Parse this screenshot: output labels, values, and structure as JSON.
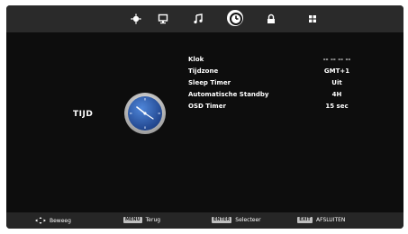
{
  "tabs": [
    {
      "icon": "picture-icon"
    },
    {
      "icon": "monitor-icon"
    },
    {
      "icon": "music-note-icon"
    },
    {
      "icon": "clock-tab-icon",
      "active": true
    },
    {
      "icon": "lock-icon"
    },
    {
      "icon": "grid-icon"
    }
  ],
  "section": {
    "label": "TIJD",
    "icon": "clock-icon",
    "accent": "#2d5fb0"
  },
  "settings": [
    {
      "label": "Klok",
      "value": "-- --   -- --"
    },
    {
      "label": "Tijdzone",
      "value": "GMT+1"
    },
    {
      "label": "Sleep Timer",
      "value": "Uit"
    },
    {
      "label": "Automatische Standby",
      "value": "4H"
    },
    {
      "label": "OSD Timer",
      "value": "15 sec"
    }
  ],
  "hints": [
    {
      "icon": "dpad-icon",
      "label": "Beweeg"
    },
    {
      "key": "MENU",
      "label": "Terug"
    },
    {
      "key": "ENTER",
      "label": "Selecteer"
    },
    {
      "key": "EXIT",
      "label": "AFSLUITEN"
    }
  ]
}
